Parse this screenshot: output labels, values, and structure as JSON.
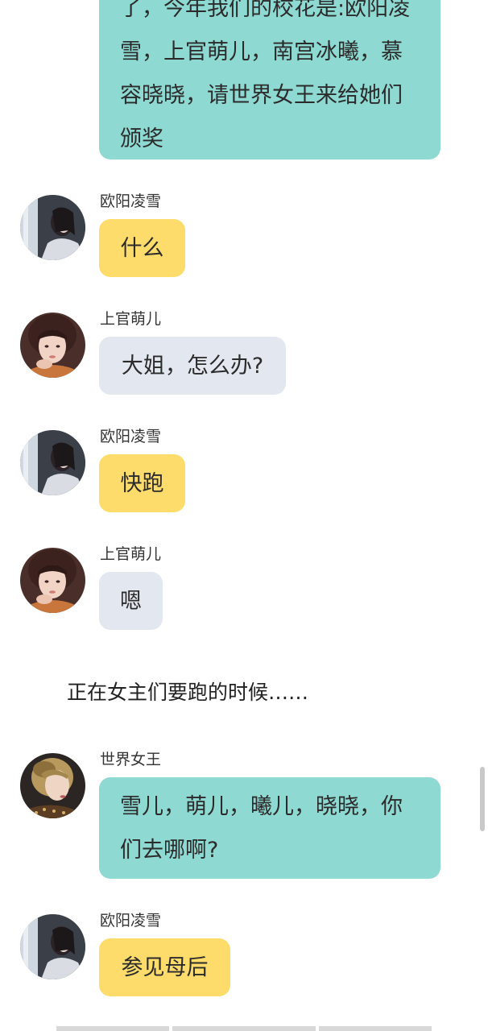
{
  "messages": [
    {
      "sender": "",
      "text": "了，今年我们的校花是:欧阳凌雪，上官萌儿，南宫冰曦，慕容晓晓，请世界女王来给她们颁奖"
    },
    {
      "sender": "欧阳凌雪",
      "text": "什么",
      "avatar": "portrait-dark-hair-window-icon"
    },
    {
      "sender": "上官萌儿",
      "text": "大姐，怎么办?",
      "avatar": "portrait-girl-bangs-icon"
    },
    {
      "sender": "欧阳凌雪",
      "text": "快跑",
      "avatar": "portrait-dark-hair-window-icon"
    },
    {
      "sender": "上官萌儿",
      "text": "嗯",
      "avatar": "portrait-girl-bangs-icon"
    },
    {
      "sender": "世界女王",
      "text": "雪儿，萌儿，曦儿，晓晓，你们去哪啊?",
      "avatar": "portrait-blonde-queen-icon"
    },
    {
      "sender": "欧阳凌雪",
      "text": "参见母后",
      "avatar": "portrait-dark-hair-window-icon"
    }
  ],
  "first_bubble_lines": [
    "了，今年我们的校花是:欧阳凌",
    "雪，上官萌儿，南宫冰曦，慕",
    "容晓晓，请世界女王来给她们",
    "颁奖"
  ],
  "queen_bubble_lines": [
    "雪儿，萌儿，曦儿，晓晓，你",
    "们去哪啊?"
  ],
  "narration": "正在女主们要跑的时候……",
  "colors": {
    "teal_bubble": "#8ed9d1",
    "yellow_bubble": "#fddc6c",
    "grey_bubble": "#e3e7ef",
    "background": "#ffffff"
  }
}
